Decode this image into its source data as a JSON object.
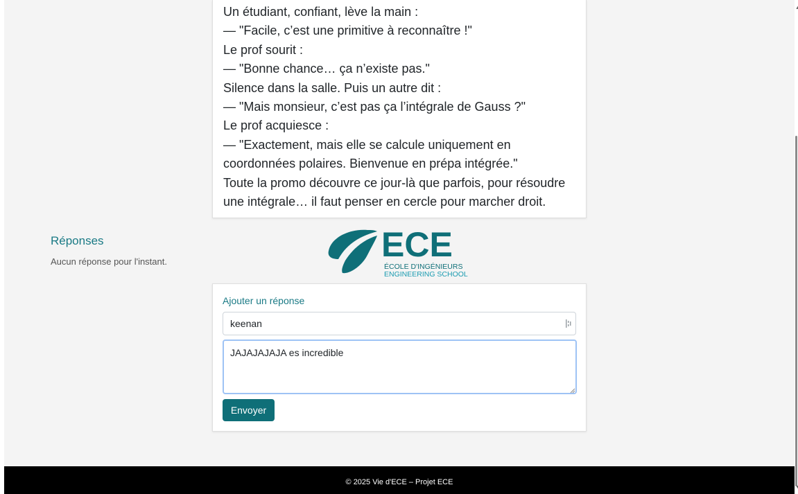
{
  "post": {
    "lines": [
      "Un étudiant, confiant, lève la main :",
      "— \"Facile, c’est une primitive à reconnaître !\"",
      "Le prof sourit :",
      "— \"Bonne chance… ça n’existe pas.\"",
      "Silence dans la salle. Puis un autre dit :",
      "— \"Mais monsieur, c’est pas ça l’intégrale de Gauss ?\"",
      "Le prof acquiesce :",
      "— \"Exactement, mais elle se calcule uniquement en",
      "coordonnées polaires. Bienvenue en prépa intégrée.\"",
      "Toute la promo découvre ce jour-là que parfois, pour résoudre",
      "une intégrale… il faut penser en cercle pour marcher droit."
    ]
  },
  "responses": {
    "title": "Réponses",
    "empty": "Aucun réponse pour l'instant."
  },
  "logo": {
    "wordmark": "ECE",
    "line1": "ÉCOLE D'INGÉNIEURS",
    "line2": "ENGINEERING SCHOOL",
    "color": "#0f6f78"
  },
  "reply_form": {
    "title": "Ajouter un réponse",
    "name_value": "keenan",
    "message_value": "JAJAJAJAJA es incredible",
    "submit_label": "Envoyer"
  },
  "footer": {
    "text": "© 2025 Vie d'ECE – Projet ECE"
  },
  "colors": {
    "accent": "#1a7a85",
    "button": "#0f6f78",
    "footer_bg": "#000000"
  }
}
